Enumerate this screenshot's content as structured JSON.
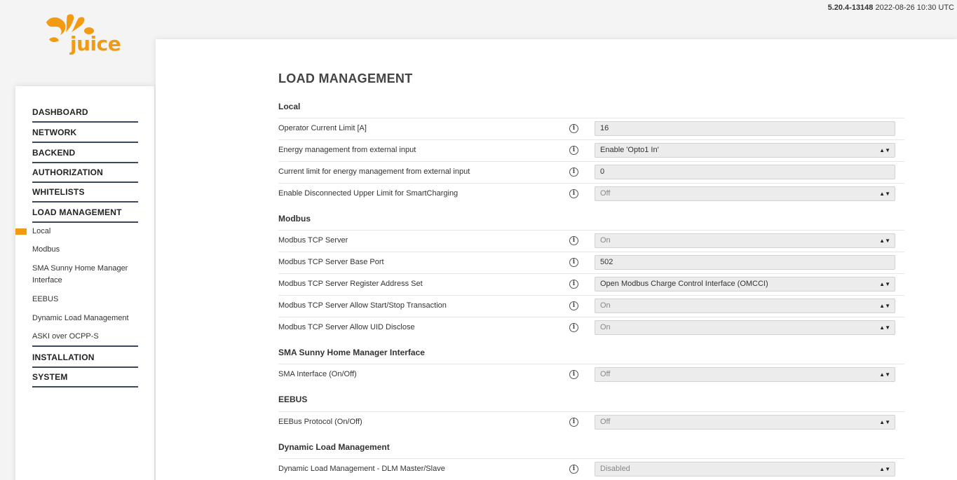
{
  "header": {
    "version": "5.20.4-13148",
    "datetime": "2022-08-26 10:30 UTC",
    "logo_text": "juice"
  },
  "sidebar": {
    "main_items": [
      {
        "label": "DASHBOARD"
      },
      {
        "label": "NETWORK"
      },
      {
        "label": "BACKEND"
      },
      {
        "label": "AUTHORIZATION"
      },
      {
        "label": "WHITELISTS"
      },
      {
        "label": "LOAD MANAGEMENT"
      },
      {
        "label": "INSTALLATION"
      },
      {
        "label": "SYSTEM"
      }
    ],
    "sub_items": [
      {
        "label": "Local",
        "active": true
      },
      {
        "label": "Modbus"
      },
      {
        "label": "SMA Sunny Home Manager Interface"
      },
      {
        "label": "EEBUS"
      },
      {
        "label": "Dynamic Load Management"
      },
      {
        "label": "ASKI over OCPP-S"
      }
    ]
  },
  "main": {
    "title": "LOAD MANAGEMENT",
    "sections": [
      {
        "title": "Local",
        "rows": [
          {
            "label": "Operator Current Limit [A]",
            "value": "16",
            "type": "input"
          },
          {
            "label": "Energy management from external input",
            "value": "Enable 'Opto1 In'",
            "type": "select"
          },
          {
            "label": "Current limit for energy management from external input",
            "value": "0",
            "type": "input"
          },
          {
            "label": "Enable Disconnected Upper Limit for SmartCharging",
            "value": "Off",
            "type": "select",
            "disabled": true
          }
        ]
      },
      {
        "title": "Modbus",
        "rows": [
          {
            "label": "Modbus TCP Server",
            "value": "On",
            "type": "select",
            "disabled": true
          },
          {
            "label": "Modbus TCP Server Base Port",
            "value": "502",
            "type": "input"
          },
          {
            "label": "Modbus TCP Server Register Address Set",
            "value": "Open Modbus Charge Control Interface (OMCCI)",
            "type": "select"
          },
          {
            "label": "Modbus TCP Server Allow Start/Stop Transaction",
            "value": "On",
            "type": "select",
            "disabled": true
          },
          {
            "label": "Modbus TCP Server Allow UID Disclose",
            "value": "On",
            "type": "select",
            "disabled": true
          }
        ]
      },
      {
        "title": "SMA Sunny Home Manager Interface",
        "rows": [
          {
            "label": "SMA Interface (On/Off)",
            "value": "Off",
            "type": "select",
            "disabled": true
          }
        ]
      },
      {
        "title": "EEBUS",
        "rows": [
          {
            "label": "EEBus Protocol (On/Off)",
            "value": "Off",
            "type": "select",
            "disabled": true
          }
        ]
      },
      {
        "title": "Dynamic Load Management",
        "rows": [
          {
            "label": "Dynamic Load Management - DLM Master/Slave",
            "value": "Disabled",
            "type": "select",
            "disabled": true
          }
        ]
      }
    ]
  },
  "colors": {
    "accent": "#f29a12",
    "nav_underline": "#3b4a5b",
    "field_bg": "#ececec"
  },
  "icons": {
    "info": "info-icon",
    "select_caret": "chevron-updown-icon",
    "logo": "juice-splash-logo"
  }
}
